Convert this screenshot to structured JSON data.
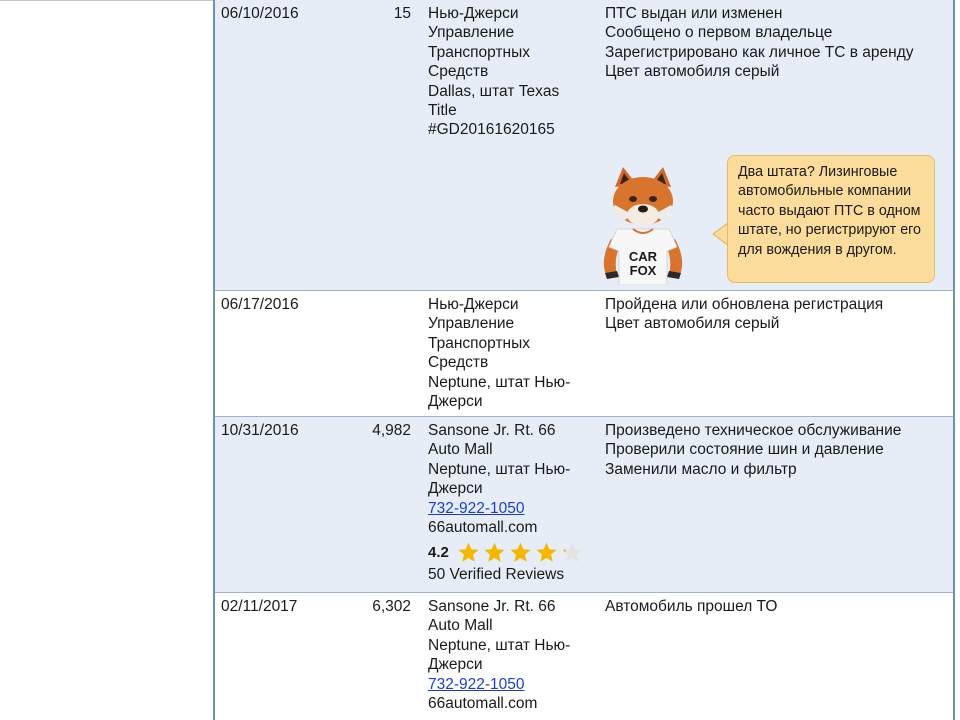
{
  "rows": [
    {
      "date": "06/10/2016",
      "mileage": "15",
      "source": [
        "Нью-Джерси",
        "Управление",
        "Транспортных",
        "Средств",
        "Dallas, штат Texas",
        "Title",
        "#GD20161620165"
      ],
      "details": [
        "ПТС выдан или изменен",
        "Сообщено о первом владельце",
        "Зарегистрировано как личное ТС в аренду",
        "Цвет автомобиля серый"
      ]
    },
    {
      "date": "06/17/2016",
      "mileage": "",
      "source": [
        "Нью-Джерси",
        "Управление",
        "Транспортных",
        "Средств",
        "Neptune, штат Нью-",
        "Джерси"
      ],
      "details": [
        "Пройдена или обновлена регистрация",
        "Цвет автомобиля серый"
      ]
    },
    {
      "date": "10/31/2016",
      "mileage": "4,982",
      "source": [
        "Sansone Jr. Rt. 66",
        "Auto Mall",
        "Neptune, штат Нью-",
        "Джерси"
      ],
      "phone": "732-922-1050",
      "website": "66automall.com",
      "rating": "4.2",
      "rating_value": 4.2,
      "reviews": "50 Verified Reviews",
      "details": [
        "Произведено техническое обслуживание",
        "Проверили состояние шин и давление",
        "Заменили масло и фильтр"
      ]
    },
    {
      "date": "02/11/2017",
      "mileage": "6,302",
      "source": [
        "Sansone Jr. Rt. 66",
        "Auto Mall",
        "Neptune, штат Нью-",
        "Джерси"
      ],
      "phone": "732-922-1050",
      "website": "66automall.com",
      "details": [
        "Автомобиль прошел ТО"
      ]
    }
  ],
  "tip": {
    "text": "Два штата? Лизинговые автомобильные компании часто выдают ПТС в одном штате, но регистрируют его для вождения в другом.",
    "mascot_shirt": [
      "CAR",
      "FOX"
    ]
  },
  "colors": {
    "row_shaded": "#e6edf7",
    "border": "#6f8fb4",
    "link": "#1a3fd0",
    "star": "#f5b800",
    "bubble": "#fbdc9b"
  }
}
